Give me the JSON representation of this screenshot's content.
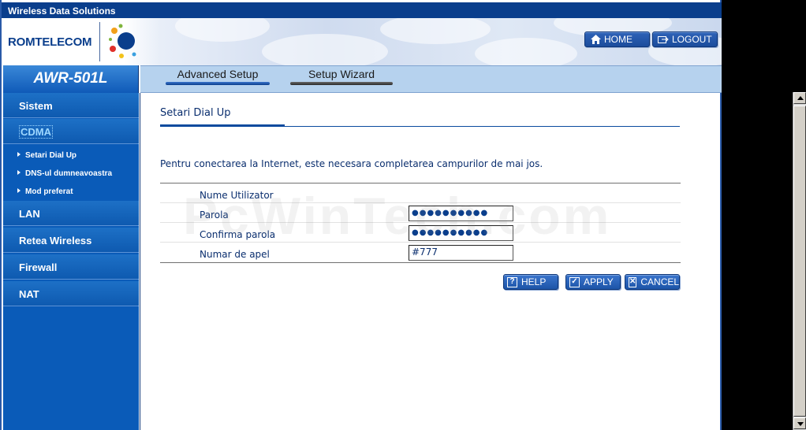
{
  "topbar": {
    "title": "Wireless Data Solutions"
  },
  "brand": {
    "name": "ROMTELECOM"
  },
  "nav": {
    "home_label": "HOME",
    "logout_label": "LOGOUT"
  },
  "model": "AWR-501L",
  "tabs": [
    {
      "label": "Advanced Setup"
    },
    {
      "label": "Setup Wizard"
    }
  ],
  "sidebar": {
    "items": [
      {
        "label": "Sistem"
      },
      {
        "label": "CDMA"
      },
      {
        "label": "LAN"
      },
      {
        "label": "Retea Wireless"
      },
      {
        "label": "Firewall"
      },
      {
        "label": "NAT"
      }
    ],
    "subitems": [
      {
        "label": "Setari Dial Up"
      },
      {
        "label": "DNS-ul dumneavoastra"
      },
      {
        "label": "Mod preferat"
      }
    ]
  },
  "main": {
    "section_title": "Setari Dial Up",
    "intro": "Pentru conectarea la Internet, este necesara completarea campurilor de mai jos.",
    "fields": [
      {
        "label": "Nume Utilizator",
        "value": ""
      },
      {
        "label": "Parola",
        "value": "●●●●●●●●●●"
      },
      {
        "label": "Confirma parola",
        "value": "●●●●●●●●●●"
      },
      {
        "label": "Numar de apel",
        "value": "#777"
      }
    ]
  },
  "watermark": "PcWinTech.com",
  "buttons": {
    "help": "HELP",
    "apply": "APPLY",
    "cancel": "CANCEL"
  },
  "colors": {
    "primary": "#0a3e8c",
    "sidebar": "#0a5bb8",
    "tabbar": "#b6d2ee",
    "background": "#000000"
  }
}
